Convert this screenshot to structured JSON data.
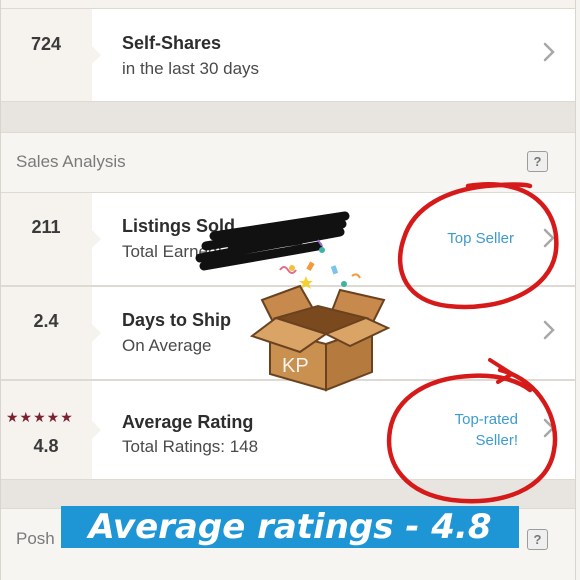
{
  "rows": {
    "self_shares": {
      "count": "724",
      "title": "Self-Shares",
      "subtitle": "in the last 30 days"
    },
    "listings_sold": {
      "count": "211",
      "title": "Listings Sold",
      "subtitle": "Total Earned: $"
    },
    "days_to_ship": {
      "count": "2.4",
      "title": "Days to Ship",
      "subtitle": "On Average"
    },
    "average_rating": {
      "stars": "★★★★★",
      "count": "4.8",
      "title": "Average Rating",
      "subtitle": "Total Ratings: 148"
    }
  },
  "sections": {
    "sales_analysis": {
      "label": "Sales Analysis",
      "help": "?"
    },
    "posh": {
      "label": "Posh",
      "help": "?"
    }
  },
  "badges": {
    "top_seller": "Top Seller",
    "top_rated_line1": "Top-rated",
    "top_rated_line2": "Seller!"
  },
  "overlay": {
    "caption": "Average ratings - 4.8",
    "box_logo": "KP"
  },
  "colors": {
    "link_blue": "#3d9bd0",
    "annotation_red": "#d61a1a",
    "caption_bg": "#1e96d6",
    "star_color": "#7a2230"
  }
}
